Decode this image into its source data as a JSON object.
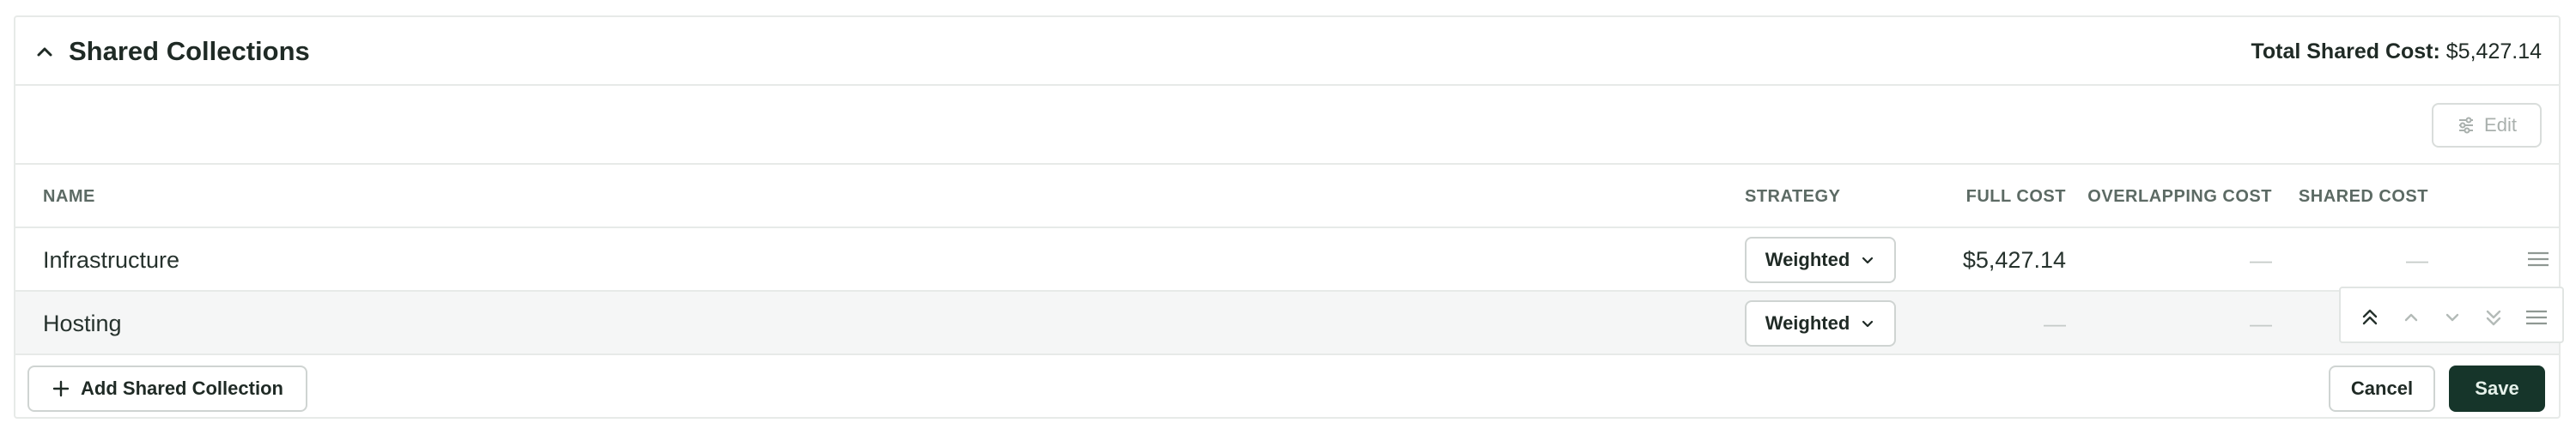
{
  "header": {
    "title": "Shared Collections",
    "total_label": "Total Shared Cost:",
    "total_value": "$5,427.14"
  },
  "toolbar": {
    "edit_label": "Edit"
  },
  "table": {
    "columns": {
      "name": "NAME",
      "strategy": "STRATEGY",
      "full_cost": "FULL COST",
      "overlapping_cost": "OVERLAPPING COST",
      "shared_cost": "SHARED COST"
    },
    "rows": [
      {
        "name": "Infrastructure",
        "strategy": "Weighted",
        "full_cost": "$5,427.14",
        "overlapping_cost": "—",
        "shared_cost": "—"
      },
      {
        "name": "Hosting",
        "strategy": "Weighted",
        "full_cost": "—",
        "overlapping_cost": "—",
        "shared_cost": "—"
      }
    ]
  },
  "footer": {
    "add_label": "Add Shared Collection",
    "cancel_label": "Cancel",
    "save_label": "Save"
  },
  "colors": {
    "primary": "#16352a",
    "border": "#e7eae8",
    "muted_text": "#5c6a64",
    "hover_row": "#f5f6f6"
  },
  "icons": [
    "chevron-up-icon",
    "sliders-icon",
    "chevron-down-icon",
    "drag-handle-icon",
    "double-chevron-up-icon",
    "double-chevron-down-icon",
    "plus-icon"
  ]
}
